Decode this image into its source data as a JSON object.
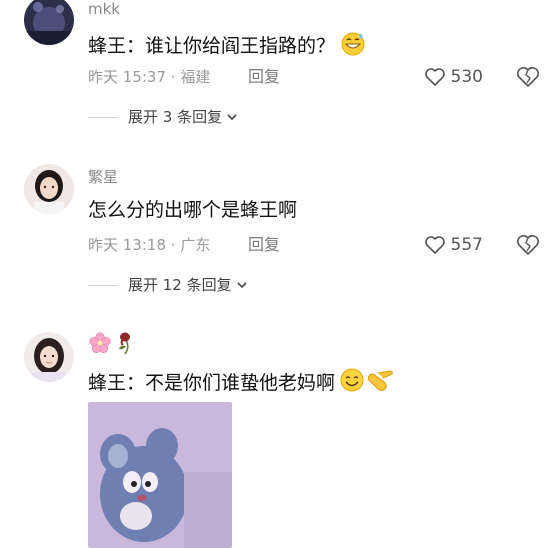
{
  "comments": [
    {
      "username": "mkk",
      "text": "蜂王：谁让你给阎王指路的？",
      "time": "昨天 15:37",
      "location": "福建",
      "reply": "回复",
      "likes": "530",
      "expand": "展开 3 条回复",
      "emoji": "grinning-sweat-emoji"
    },
    {
      "username": "繁星",
      "text": "怎么分的出哪个是蜂王啊",
      "time": "昨天 13:18",
      "location": "广东",
      "reply": "回复",
      "likes": "557",
      "expand": "展开 12 条回复"
    },
    {
      "username_emojis": [
        "cherry-blossom-emoji",
        "wilted-rose-emoji"
      ],
      "text": "蜂王：不是你们谁蛰他老妈啊",
      "emojis": [
        "smiling-face-emoji",
        "pointing-hand-emoji"
      ],
      "sticker": "tom-cat-sticker"
    }
  ],
  "colors": {
    "text": "#111111",
    "meta": "#9a9a9a",
    "username": "#8a8a8a"
  }
}
